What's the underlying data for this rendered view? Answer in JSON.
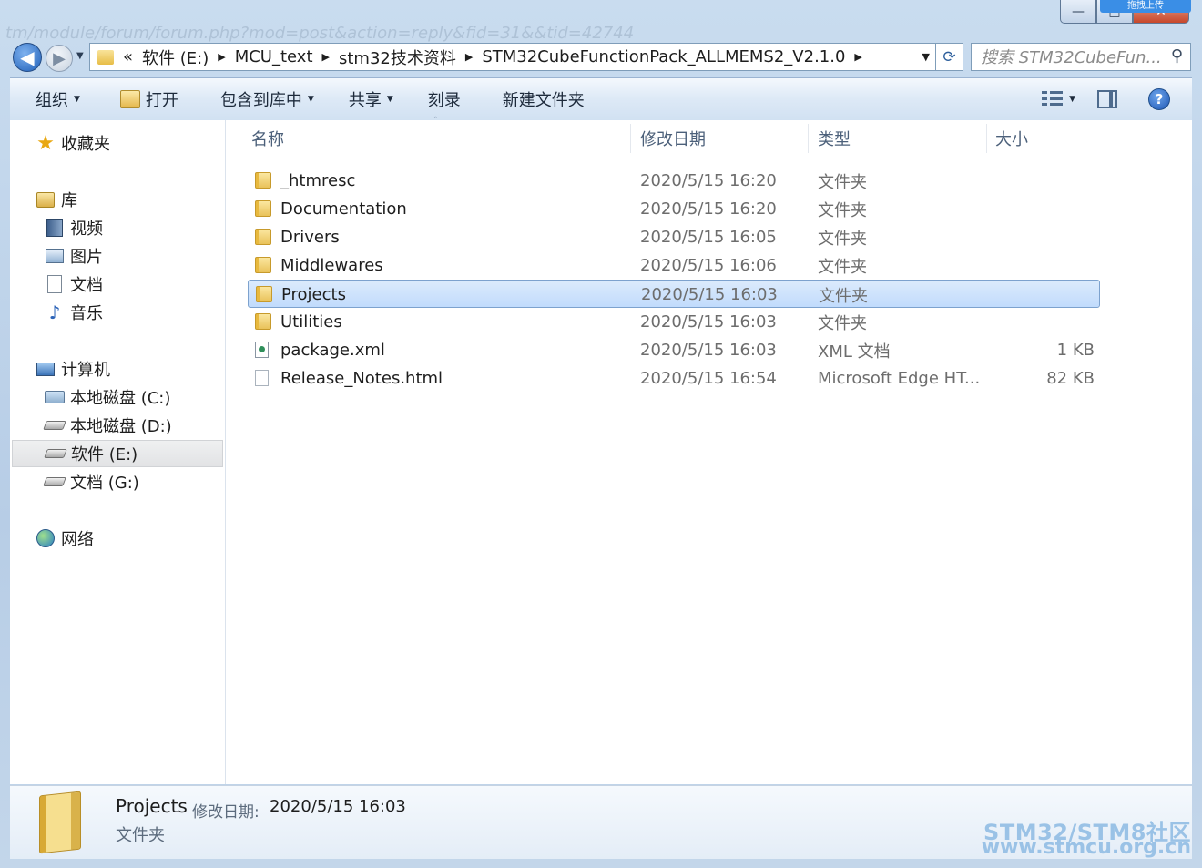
{
  "window": {
    "background_url_text": "tm/module/forum/forum.php?mod=post&action=reply&fid=31&&tid=42744",
    "upload_badge": "拖拽上传",
    "caption": {
      "minimize": "—",
      "maximize": "□",
      "close": "✕"
    }
  },
  "nav": {
    "back_glyph": "◀",
    "forward_glyph": "▶",
    "history_dropdown": "▼",
    "refresh_glyph": "⟳",
    "address": {
      "overflow": "«",
      "segments": [
        "软件 (E:)",
        "MCU_text",
        "stm32技术资料",
        "STM32CubeFunctionPack_ALLMEMS2_V2.1.0"
      ],
      "separator": "▶",
      "dropdown": "▼"
    },
    "search": {
      "placeholder": "搜索 STM32CubeFun...",
      "value": "",
      "icon": "search-icon",
      "glyph": "⚲"
    }
  },
  "toolbar": {
    "organize": "组织",
    "open": "打开",
    "include_library": "包含到库中",
    "share": "共享",
    "burn": "刻录",
    "new_folder": "新建文件夹",
    "dropdown_glyph": "▼",
    "help_glyph": "?"
  },
  "sidebar": {
    "favorites": {
      "label": "收藏夹",
      "icon": "star-icon",
      "glyph": "★"
    },
    "libraries": {
      "label": "库",
      "items": [
        {
          "label": "视频",
          "icon": "video-library-icon"
        },
        {
          "label": "图片",
          "icon": "pictures-library-icon"
        },
        {
          "label": "文档",
          "icon": "documents-library-icon"
        },
        {
          "label": "音乐",
          "icon": "music-library-icon",
          "glyph": "♪"
        }
      ]
    },
    "computer": {
      "label": "计算机",
      "items": [
        {
          "label": "本地磁盘 (C:)",
          "icon": "drive-c-icon"
        },
        {
          "label": "本地磁盘 (D:)",
          "icon": "drive-icon"
        },
        {
          "label": "软件 (E:)",
          "icon": "drive-icon",
          "selected": true
        },
        {
          "label": "文档 (G:)",
          "icon": "drive-icon"
        }
      ]
    },
    "network": {
      "label": "网络",
      "icon": "network-icon"
    }
  },
  "file_list": {
    "columns": {
      "name": "名称",
      "modified": "修改日期",
      "type": "类型",
      "size": "大小"
    },
    "sort_glyph": "˄",
    "rows": [
      {
        "name": "_htmresc",
        "modified": "2020/5/15 16:20",
        "type": "文件夹",
        "size": "",
        "icon": "folder"
      },
      {
        "name": "Documentation",
        "modified": "2020/5/15 16:20",
        "type": "文件夹",
        "size": "",
        "icon": "folder"
      },
      {
        "name": "Drivers",
        "modified": "2020/5/15 16:05",
        "type": "文件夹",
        "size": "",
        "icon": "folder"
      },
      {
        "name": "Middlewares",
        "modified": "2020/5/15 16:06",
        "type": "文件夹",
        "size": "",
        "icon": "folder"
      },
      {
        "name": "Projects",
        "modified": "2020/5/15 16:03",
        "type": "文件夹",
        "size": "",
        "icon": "folder",
        "selected": true
      },
      {
        "name": "Utilities",
        "modified": "2020/5/15 16:03",
        "type": "文件夹",
        "size": "",
        "icon": "folder"
      },
      {
        "name": "package.xml",
        "modified": "2020/5/15 16:03",
        "type": "XML 文档",
        "size": "1 KB",
        "icon": "xml"
      },
      {
        "name": "Release_Notes.html",
        "modified": "2020/5/15 16:54",
        "type": "Microsoft Edge HT...",
        "size": "82 KB",
        "icon": "html"
      }
    ]
  },
  "details": {
    "name": "Projects",
    "modified_label": "修改日期:",
    "modified_value": "2020/5/15 16:03",
    "type": "文件夹"
  },
  "watermark": {
    "line1": "STM32/STM8社区",
    "line2": "www.stmcu.org.cn"
  },
  "colors": {
    "selection": "#cce4fc",
    "selection_border": "#7da2ce",
    "accent": "#1f5fb8"
  }
}
